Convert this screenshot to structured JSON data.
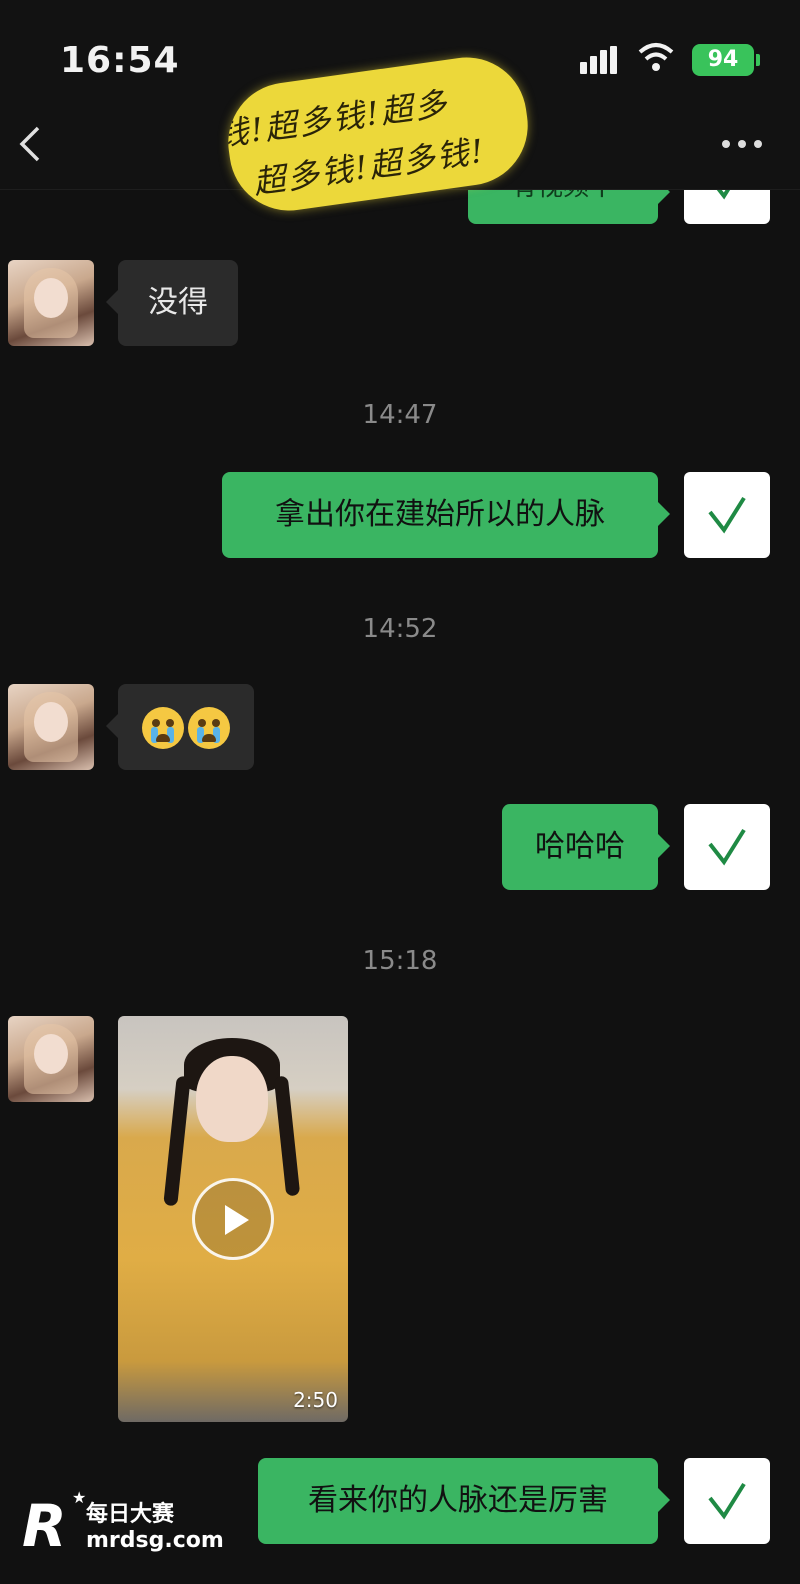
{
  "status_bar": {
    "time": "16:54",
    "battery": "94"
  },
  "sticker": {
    "lines": [
      "钱!超多钱!超多",
      "超多钱!超多钱!"
    ]
  },
  "top_partial_bubble": "有视频干",
  "messages": [
    {
      "from": "contact",
      "type": "text",
      "text": "没得"
    },
    {
      "type": "timestamp",
      "text": "14:47"
    },
    {
      "from": "self",
      "type": "text",
      "text": "拿出你在建始所以的人脉"
    },
    {
      "type": "timestamp",
      "text": "14:52"
    },
    {
      "from": "contact",
      "type": "emoji",
      "emoji": [
        "crying-face",
        "crying-face"
      ]
    },
    {
      "from": "self",
      "type": "text",
      "text": "哈哈哈"
    },
    {
      "type": "timestamp",
      "text": "15:18"
    },
    {
      "from": "contact",
      "type": "video",
      "duration": "2:50"
    },
    {
      "from": "self",
      "type": "text",
      "text": "看来你的人脉还是厉害"
    }
  ],
  "watermark": {
    "logo_letter": "R",
    "name": "每日大赛",
    "url": "mrdsg.com"
  },
  "colors": {
    "background": "#111111",
    "bubble_in": "#2b2b2b",
    "bubble_out": "#3ab562",
    "sticker": "#ecd83a",
    "battery": "#39c35b"
  }
}
